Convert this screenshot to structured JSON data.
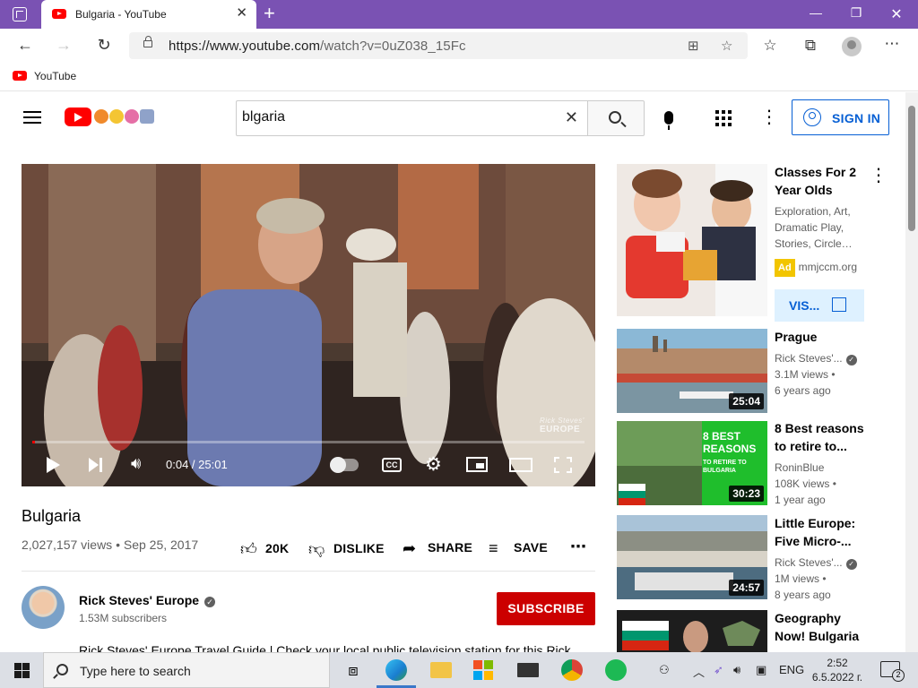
{
  "browser": {
    "tab_title": "Bulgaria - YouTube",
    "url_host": "https://www.youtube.com",
    "url_path": "/watch?v=0uZ038_15Fc",
    "favorites": [
      {
        "label": "YouTube"
      }
    ]
  },
  "youtube": {
    "search_value": "blgaria",
    "signin_label": "SIGN IN",
    "video": {
      "time": "0:04 / 25:01",
      "progress": 0.003,
      "watermark_script": "Rick Steves'",
      "watermark_text": "EUROPE",
      "title": "Bulgaria",
      "stats": "2,027,157 views • Sep 25, 2017",
      "like_count": "20K",
      "dislike_label": "DISLIKE",
      "share_label": "SHARE",
      "save_label": "SAVE",
      "channel": "Rick Steves' Europe",
      "subscribers": "1.53M subscribers",
      "subscribe_label": "SUBSCRIBE",
      "description": "Rick Steves' Europe Travel Guide | Check your local public television station for this Rick"
    },
    "ad": {
      "title": "Classes For 2 Year Olds",
      "desc_lines": [
        "Exploration, Art,",
        "Dramatic Play,",
        "Stories, Circle…"
      ],
      "badge": "Ad",
      "domain": "mmjccm.org",
      "visit_label": "VIS..."
    },
    "recommendations": [
      {
        "title": "Prague",
        "channel": "Rick Steves'...",
        "views": "3.1M views •",
        "age": "6 years ago",
        "duration": "25:04"
      },
      {
        "title": "8 Best reasons to retire to...",
        "channel": "RoninBlue",
        "views": "108K views •",
        "age": "1 year ago",
        "duration": "30:23",
        "thumb_text": "8 BEST REASONS",
        "thumb_sub": "TO RETIRE TO BULGARIA"
      },
      {
        "title": "Little Europe: Five Micro-...",
        "channel": "Rick Steves'...",
        "views": "1M views •",
        "age": "8 years ago",
        "duration": "24:57"
      },
      {
        "title": "Geography Now! Bulgaria"
      }
    ]
  },
  "taskbar": {
    "search_placeholder": "Type here to search",
    "language": "ENG",
    "time": "2:52",
    "date": "6.5.2022 г.",
    "notification_count": "2"
  },
  "colors": {
    "browser_accent": "#7a52b3",
    "youtube_red": "#ff0000",
    "subscribe": "#cc0000",
    "link_blue": "#065fd4"
  }
}
